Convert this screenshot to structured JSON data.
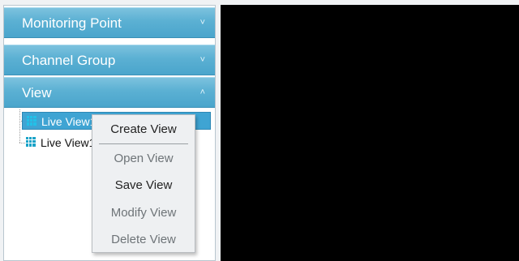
{
  "sidebar": {
    "sections": [
      {
        "label": "Monitoring Point",
        "chevron": "˅"
      },
      {
        "label": "Channel Group",
        "chevron": "˅"
      },
      {
        "label": "View",
        "chevron": "˄"
      }
    ],
    "tree_items": [
      {
        "label": "Live View11",
        "icon": "grid-icon",
        "selected": true
      },
      {
        "label": "Live View1",
        "icon": "grid-icon",
        "selected": false
      }
    ]
  },
  "context_menu": {
    "items": [
      {
        "label": "Create View",
        "enabled": true
      },
      {
        "label": "Open View",
        "enabled": false
      },
      {
        "label": "Save View",
        "enabled": true
      },
      {
        "label": "Modify View",
        "enabled": false
      },
      {
        "label": "Delete View",
        "enabled": false
      }
    ]
  },
  "colors": {
    "header_accent": "#4aa5cc",
    "selected_item": "#3fa4d3",
    "video_background": "#000000"
  }
}
